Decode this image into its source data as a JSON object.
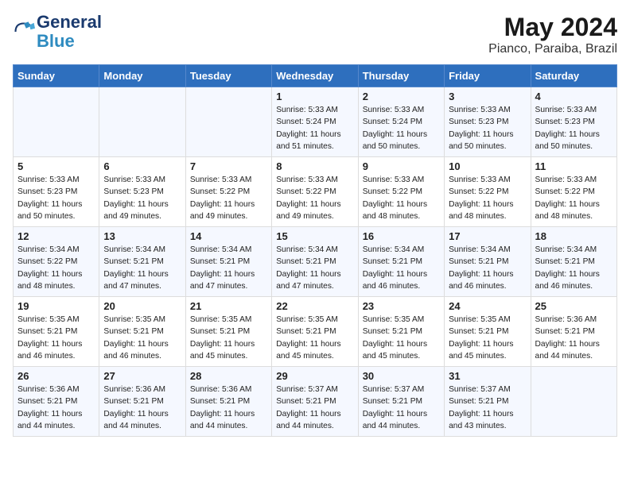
{
  "header": {
    "logo_line1": "General",
    "logo_line2": "Blue",
    "month_year": "May 2024",
    "location": "Pianco, Paraiba, Brazil"
  },
  "weekdays": [
    "Sunday",
    "Monday",
    "Tuesday",
    "Wednesday",
    "Thursday",
    "Friday",
    "Saturday"
  ],
  "weeks": [
    [
      {
        "day": "",
        "info": ""
      },
      {
        "day": "",
        "info": ""
      },
      {
        "day": "",
        "info": ""
      },
      {
        "day": "1",
        "info": "Sunrise: 5:33 AM\nSunset: 5:24 PM\nDaylight: 11 hours\nand 51 minutes."
      },
      {
        "day": "2",
        "info": "Sunrise: 5:33 AM\nSunset: 5:24 PM\nDaylight: 11 hours\nand 50 minutes."
      },
      {
        "day": "3",
        "info": "Sunrise: 5:33 AM\nSunset: 5:23 PM\nDaylight: 11 hours\nand 50 minutes."
      },
      {
        "day": "4",
        "info": "Sunrise: 5:33 AM\nSunset: 5:23 PM\nDaylight: 11 hours\nand 50 minutes."
      }
    ],
    [
      {
        "day": "5",
        "info": "Sunrise: 5:33 AM\nSunset: 5:23 PM\nDaylight: 11 hours\nand 50 minutes."
      },
      {
        "day": "6",
        "info": "Sunrise: 5:33 AM\nSunset: 5:23 PM\nDaylight: 11 hours\nand 49 minutes."
      },
      {
        "day": "7",
        "info": "Sunrise: 5:33 AM\nSunset: 5:22 PM\nDaylight: 11 hours\nand 49 minutes."
      },
      {
        "day": "8",
        "info": "Sunrise: 5:33 AM\nSunset: 5:22 PM\nDaylight: 11 hours\nand 49 minutes."
      },
      {
        "day": "9",
        "info": "Sunrise: 5:33 AM\nSunset: 5:22 PM\nDaylight: 11 hours\nand 48 minutes."
      },
      {
        "day": "10",
        "info": "Sunrise: 5:33 AM\nSunset: 5:22 PM\nDaylight: 11 hours\nand 48 minutes."
      },
      {
        "day": "11",
        "info": "Sunrise: 5:33 AM\nSunset: 5:22 PM\nDaylight: 11 hours\nand 48 minutes."
      }
    ],
    [
      {
        "day": "12",
        "info": "Sunrise: 5:34 AM\nSunset: 5:22 PM\nDaylight: 11 hours\nand 48 minutes."
      },
      {
        "day": "13",
        "info": "Sunrise: 5:34 AM\nSunset: 5:21 PM\nDaylight: 11 hours\nand 47 minutes."
      },
      {
        "day": "14",
        "info": "Sunrise: 5:34 AM\nSunset: 5:21 PM\nDaylight: 11 hours\nand 47 minutes."
      },
      {
        "day": "15",
        "info": "Sunrise: 5:34 AM\nSunset: 5:21 PM\nDaylight: 11 hours\nand 47 minutes."
      },
      {
        "day": "16",
        "info": "Sunrise: 5:34 AM\nSunset: 5:21 PM\nDaylight: 11 hours\nand 46 minutes."
      },
      {
        "day": "17",
        "info": "Sunrise: 5:34 AM\nSunset: 5:21 PM\nDaylight: 11 hours\nand 46 minutes."
      },
      {
        "day": "18",
        "info": "Sunrise: 5:34 AM\nSunset: 5:21 PM\nDaylight: 11 hours\nand 46 minutes."
      }
    ],
    [
      {
        "day": "19",
        "info": "Sunrise: 5:35 AM\nSunset: 5:21 PM\nDaylight: 11 hours\nand 46 minutes."
      },
      {
        "day": "20",
        "info": "Sunrise: 5:35 AM\nSunset: 5:21 PM\nDaylight: 11 hours\nand 46 minutes."
      },
      {
        "day": "21",
        "info": "Sunrise: 5:35 AM\nSunset: 5:21 PM\nDaylight: 11 hours\nand 45 minutes."
      },
      {
        "day": "22",
        "info": "Sunrise: 5:35 AM\nSunset: 5:21 PM\nDaylight: 11 hours\nand 45 minutes."
      },
      {
        "day": "23",
        "info": "Sunrise: 5:35 AM\nSunset: 5:21 PM\nDaylight: 11 hours\nand 45 minutes."
      },
      {
        "day": "24",
        "info": "Sunrise: 5:35 AM\nSunset: 5:21 PM\nDaylight: 11 hours\nand 45 minutes."
      },
      {
        "day": "25",
        "info": "Sunrise: 5:36 AM\nSunset: 5:21 PM\nDaylight: 11 hours\nand 44 minutes."
      }
    ],
    [
      {
        "day": "26",
        "info": "Sunrise: 5:36 AM\nSunset: 5:21 PM\nDaylight: 11 hours\nand 44 minutes."
      },
      {
        "day": "27",
        "info": "Sunrise: 5:36 AM\nSunset: 5:21 PM\nDaylight: 11 hours\nand 44 minutes."
      },
      {
        "day": "28",
        "info": "Sunrise: 5:36 AM\nSunset: 5:21 PM\nDaylight: 11 hours\nand 44 minutes."
      },
      {
        "day": "29",
        "info": "Sunrise: 5:37 AM\nSunset: 5:21 PM\nDaylight: 11 hours\nand 44 minutes."
      },
      {
        "day": "30",
        "info": "Sunrise: 5:37 AM\nSunset: 5:21 PM\nDaylight: 11 hours\nand 44 minutes."
      },
      {
        "day": "31",
        "info": "Sunrise: 5:37 AM\nSunset: 5:21 PM\nDaylight: 11 hours\nand 43 minutes."
      },
      {
        "day": "",
        "info": ""
      }
    ]
  ]
}
